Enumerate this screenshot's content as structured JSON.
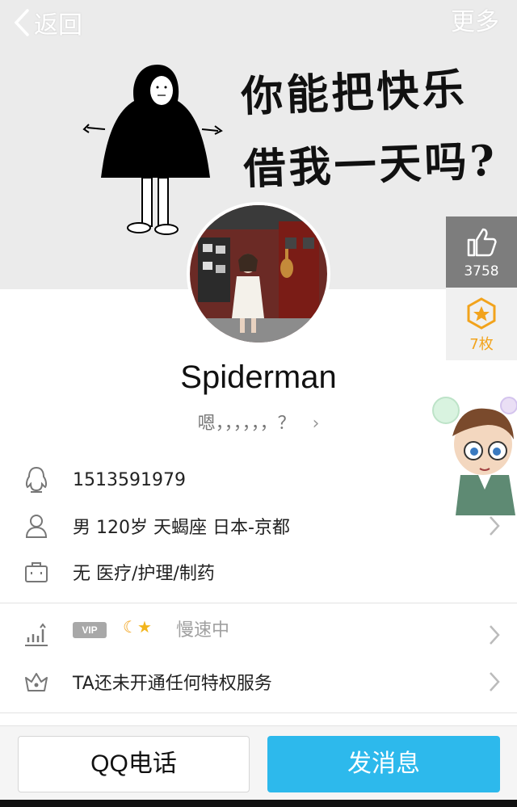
{
  "header": {
    "back_label": "返回",
    "more_label": "更多"
  },
  "cover": {
    "line1": "你能把快乐",
    "line2": "借我一天吗?"
  },
  "stats": {
    "likes": "3758",
    "medals": "7枚"
  },
  "profile": {
    "name": "Spiderman",
    "signature": "嗯，，，，，，？",
    "qq": "1513591979",
    "basic_info": "男  120岁  天蝎座  日本-京都",
    "job": "无 医疗/护理/制药"
  },
  "vip": {
    "tag": "VIP",
    "status": "慢速中",
    "privilege": "TA还未开通任何特权服务"
  },
  "actions": {
    "call_label": "QQ电话",
    "message_label": "发消息"
  },
  "colors": {
    "accent": "#2db9ec",
    "medal": "#f2a31c",
    "like_bg": "#7d7d7d"
  }
}
